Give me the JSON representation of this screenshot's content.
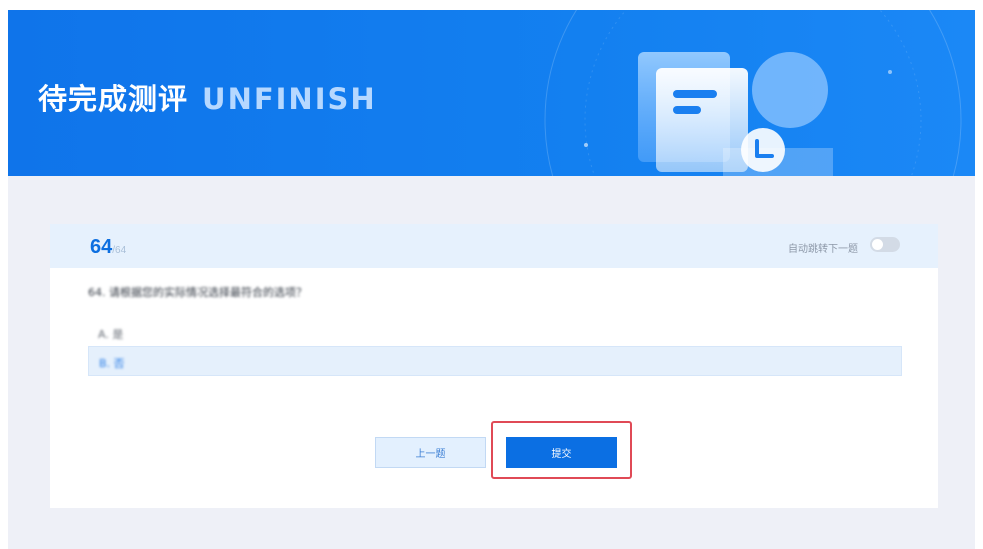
{
  "banner": {
    "title_cn": "待完成测评",
    "title_en": "UNFINISH"
  },
  "question_card": {
    "current_number": "64",
    "total_suffix": "/64",
    "auto_next_label": "自动跳转下一题",
    "auto_next_enabled": false,
    "question_text": "64. 请根据您的实际情况选择最符合的选项？",
    "options": [
      {
        "label": "A. 是",
        "selected": false
      },
      {
        "label": "B. 否",
        "selected": true
      }
    ]
  },
  "actions": {
    "prev_label": "上一题",
    "submit_label": "提交"
  },
  "colors": {
    "banner_blue": "#0f74ea",
    "primary_button": "#0b6fe3",
    "header_bg": "#e6f1fd",
    "highlight_border": "#e04a56"
  }
}
